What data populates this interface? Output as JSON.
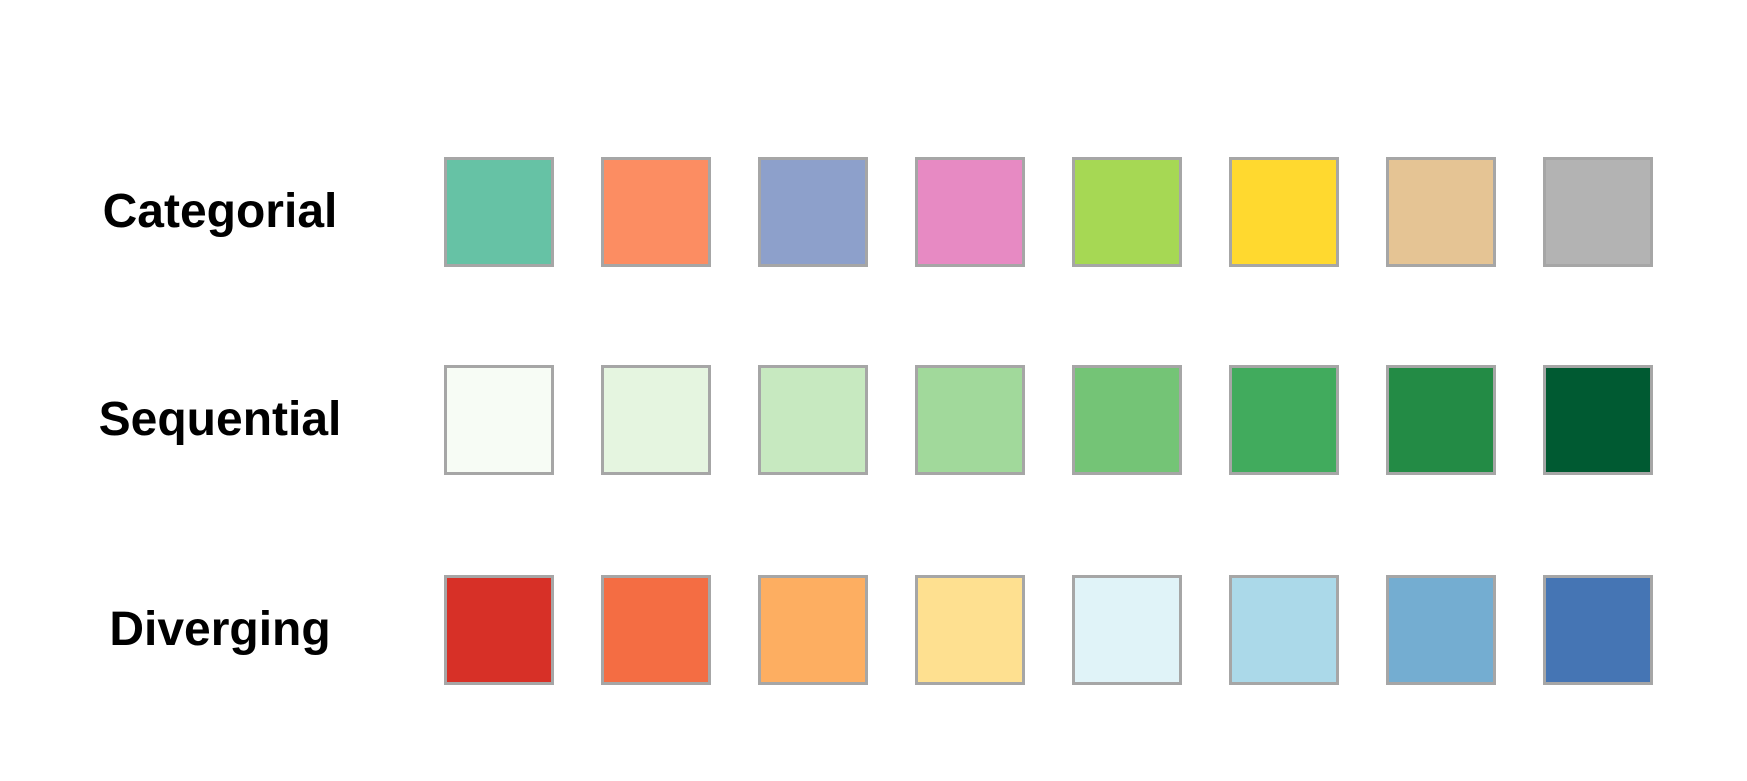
{
  "palettes": [
    {
      "label": "Categorial",
      "colors": [
        "#66c2a5",
        "#fc8d62",
        "#8da0cb",
        "#e78ac3",
        "#a6d854",
        "#ffd92f",
        "#e5c494",
        "#b3b3b3"
      ]
    },
    {
      "label": "Sequential",
      "colors": [
        "#f7fcf5",
        "#e5f5e0",
        "#c7e9c0",
        "#a1d99b",
        "#74c476",
        "#41ab5d",
        "#238b45",
        "#005a32"
      ]
    },
    {
      "label": "Diverging",
      "colors": [
        "#d73027",
        "#f46d43",
        "#fdae61",
        "#fee090",
        "#e0f3f8",
        "#abd9e9",
        "#74add1",
        "#4575b4"
      ]
    }
  ],
  "swatch_border_color": "#a6a6a6"
}
